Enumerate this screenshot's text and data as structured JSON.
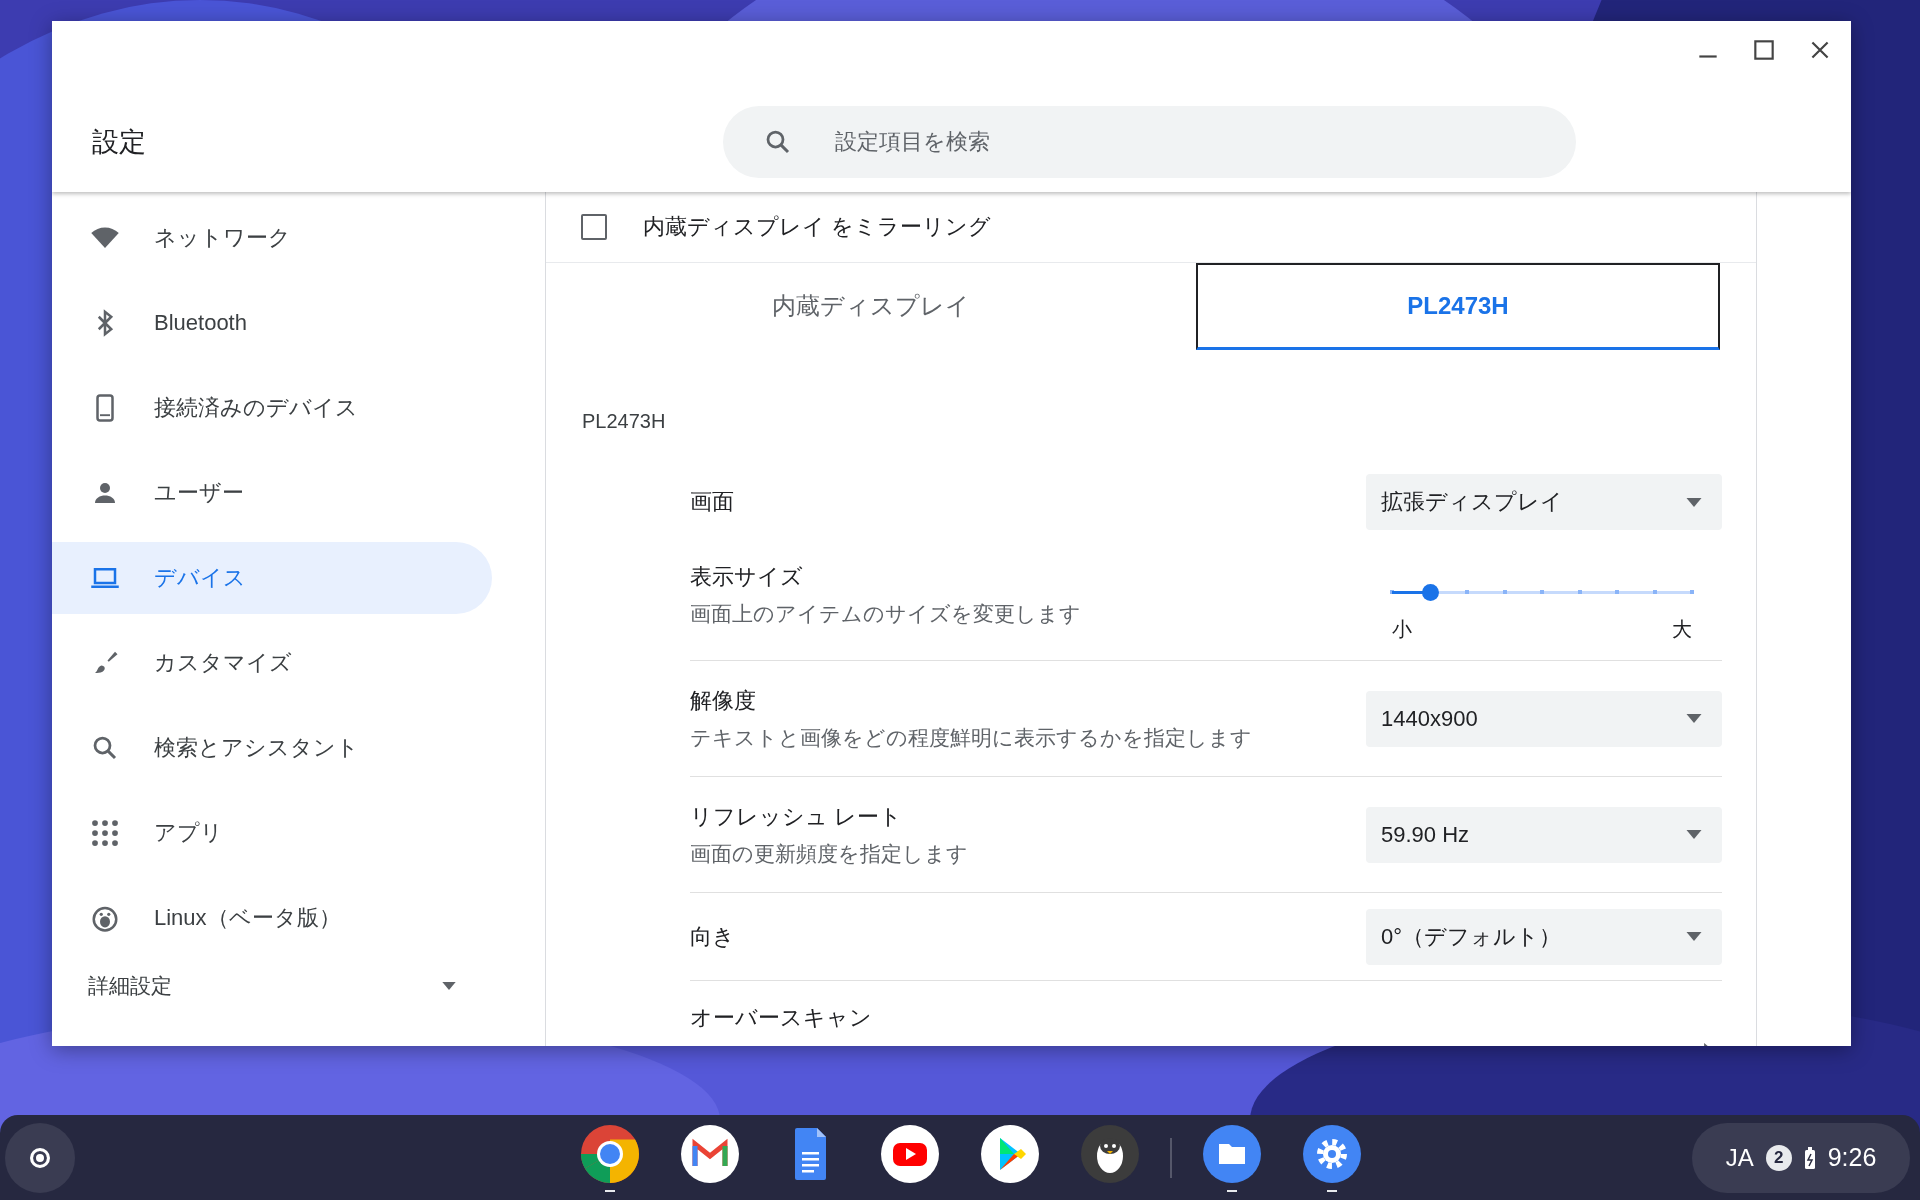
{
  "window": {
    "title": "設定"
  },
  "search": {
    "placeholder": "設定項目を検索"
  },
  "sidebar": {
    "items": [
      {
        "kind": "wifi",
        "label": "ネットワーク",
        "selected": false
      },
      {
        "kind": "bluetooth",
        "label": "Bluetooth",
        "selected": false
      },
      {
        "kind": "phone",
        "label": "接続済みのデバイス",
        "selected": false
      },
      {
        "kind": "person",
        "label": "ユーザー",
        "selected": false
      },
      {
        "kind": "laptop",
        "label": "デバイス",
        "selected": true
      },
      {
        "kind": "brush",
        "label": "カスタマイズ",
        "selected": false
      },
      {
        "kind": "search",
        "label": "検索とアシスタント",
        "selected": false
      },
      {
        "kind": "apps",
        "label": "アプリ",
        "selected": false
      },
      {
        "kind": "penguin",
        "label": "Linux（ベータ版）",
        "selected": false
      }
    ],
    "advanced": {
      "label": "詳細設定",
      "expanded": false
    }
  },
  "mirror": {
    "label": "内蔵ディスプレイ をミラーリング",
    "checked": false
  },
  "display_tabs": [
    {
      "label": "内蔵ディスプレイ",
      "selected": false
    },
    {
      "label": "PL2473H",
      "selected": true
    }
  ],
  "section_title": "PL2473H",
  "rows": [
    {
      "kind": "dropdown",
      "label": "画面",
      "value": "拡張ディスプレイ"
    },
    {
      "kind": "slider",
      "label": "表示サイズ",
      "description": "画面上のアイテムのサイズを変更します",
      "level": 0.125,
      "min_label": "小",
      "max_label": "大"
    },
    {
      "kind": "dropdown",
      "label": "解像度",
      "description": "テキストと画像をどの程度鮮明に表示するかを指定します",
      "value": "1440x900"
    },
    {
      "kind": "dropdown",
      "label": "リフレッシュ レート",
      "description": "画面の更新頻度を指定します",
      "value": "59.90 Hz"
    },
    {
      "kind": "dropdown",
      "label": "向き",
      "value": "0°（デフォルト）"
    },
    {
      "kind": "link",
      "label": "オーバースキャン"
    }
  ],
  "taskbar": {
    "apps": [
      {
        "kind": "chrome",
        "running": true
      },
      {
        "kind": "gmail",
        "running": false
      },
      {
        "kind": "docs",
        "running": false
      },
      {
        "kind": "youtube",
        "running": false
      },
      {
        "kind": "play",
        "running": false
      },
      {
        "kind": "penguin",
        "running": false
      },
      {
        "kind": "files",
        "running": true
      },
      {
        "kind": "settings",
        "running": true
      }
    ],
    "tray": {
      "ime": "JA",
      "notifications": "2",
      "time": "9:26"
    }
  }
}
